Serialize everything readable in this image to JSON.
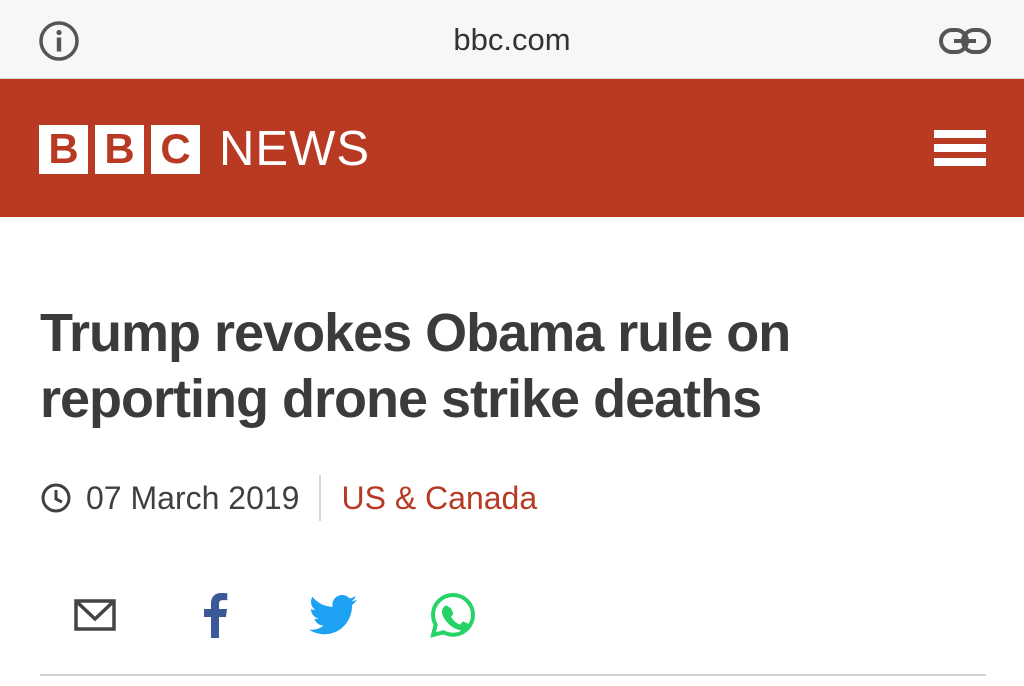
{
  "browser": {
    "url": "bbc.com",
    "icons": [
      "info-icon",
      "link-icon"
    ]
  },
  "header": {
    "logo_letters": [
      "B",
      "B",
      "C"
    ],
    "logo_word": "NEWS",
    "brand_color": "#b83a23",
    "menu_icon": "hamburger-menu-icon"
  },
  "article": {
    "headline": "Trump revokes Obama rule on reporting drone strike deaths",
    "date": "07 March 2019",
    "section": "US & Canada",
    "date_icon": "clock-icon"
  },
  "share": {
    "buttons": [
      {
        "icon": "email-icon",
        "color": "#444444"
      },
      {
        "icon": "facebook-icon",
        "color": "#3b5998"
      },
      {
        "icon": "twitter-icon",
        "color": "#1da1f2"
      },
      {
        "icon": "whatsapp-icon",
        "color": "#25d366"
      }
    ]
  }
}
